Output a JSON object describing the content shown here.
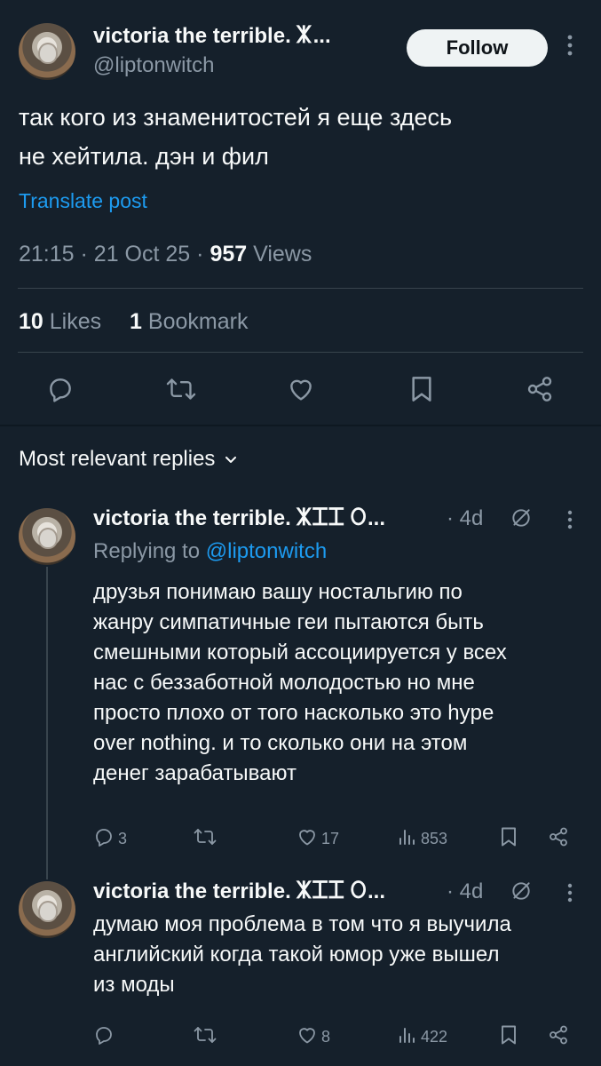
{
  "post": {
    "author_name": "victoria the terrible. 𐊌...",
    "author_handle": "@liptonwitch",
    "follow_label": "Follow",
    "text_line1": "так кого из знаменитостей я еще здесь",
    "text_line2": "не хейтила. дэн и фил",
    "translate_label": "Translate post",
    "time": "21:15",
    "date": "21 Oct 25",
    "views_count": "957",
    "views_label": "Views",
    "likes_count": "10",
    "likes_label": "Likes",
    "bookmarks_count": "1",
    "bookmarks_label": "Bookmark"
  },
  "replies_header": "Most relevant replies",
  "replies": [
    {
      "author_name": "victoria the terrible. 𐊌𐊈𐊈 𐊒...",
      "age": "4d",
      "replying_prefix": "Replying to",
      "replying_handle": "@liptonwitch",
      "lines": [
        "друзья понимаю вашу ностальгию по",
        "жанру симпатичные геи пытаются быть",
        "смешными который ассоциируется у всех",
        "нас с беззаботной молодостью но мне",
        "просто плохо от того насколько это hype",
        "over nothing. и то сколько они на этом",
        "денег зарабатывают"
      ],
      "replies_count": "3",
      "likes_count": "17",
      "views_count": "853"
    },
    {
      "author_name": "victoria the terrible. 𐊌𐊈𐊈 𐊒...",
      "age": "4d",
      "lines": [
        "думаю моя проблема в том что я выучила",
        "английский когда такой юмор уже вышел",
        "из моды"
      ],
      "likes_count": "8",
      "views_count": "422"
    }
  ],
  "colors": {
    "background": "#15202b",
    "text": "#f7f9f9",
    "muted": "#8b98a5",
    "link": "#1d9bf0",
    "divider": "#38444d",
    "follow_bg": "#eff3f4"
  },
  "icons": [
    "more-icon",
    "reply-icon",
    "repost-icon",
    "like-icon",
    "bookmark-icon",
    "share-icon",
    "views-icon",
    "grok-icon",
    "chevron-down-icon"
  ]
}
